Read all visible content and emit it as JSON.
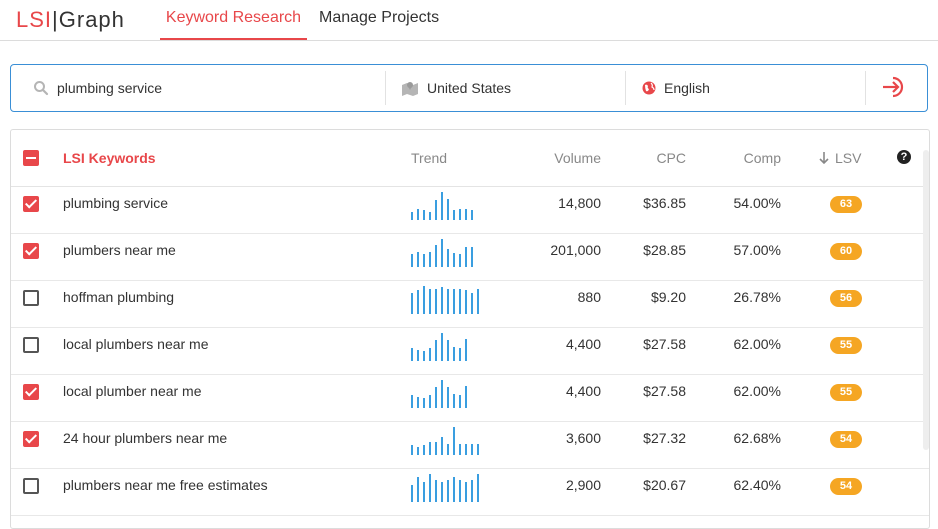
{
  "header": {
    "logo_lsi": "LSI",
    "logo_graph": "Graph",
    "nav": [
      "Keyword Research",
      "Manage Projects"
    ]
  },
  "search": {
    "keyword": "plumbing service",
    "country": "United States",
    "language": "English"
  },
  "table": {
    "columns": {
      "keyword": "LSI Keywords",
      "trend": "Trend",
      "volume": "Volume",
      "cpc": "CPC",
      "comp": "Comp",
      "lsv": "LSV"
    },
    "rows": [
      {
        "checked": true,
        "keyword": "plumbing service",
        "volume": "14,800",
        "cpc": "$36.85",
        "comp": "54.00%",
        "lsv": "63",
        "trend": [
          0.3,
          0.4,
          0.35,
          0.3,
          0.7,
          1.0,
          0.75,
          0.35,
          0.4,
          0.4,
          0.35
        ]
      },
      {
        "checked": true,
        "keyword": "plumbers near me",
        "volume": "201,000",
        "cpc": "$28.85",
        "comp": "57.00%",
        "lsv": "60",
        "trend": [
          0.45,
          0.55,
          0.45,
          0.55,
          0.8,
          1.0,
          0.65,
          0.5,
          0.45,
          0.7,
          0.7
        ]
      },
      {
        "checked": false,
        "keyword": "hoffman plumbing",
        "volume": "880",
        "cpc": "$9.20",
        "comp": "26.78%",
        "lsv": "56",
        "trend": [
          0.75,
          0.85,
          1.0,
          0.9,
          0.9,
          0.95,
          0.9,
          0.9,
          0.9,
          0.85,
          0.75,
          0.9
        ]
      },
      {
        "checked": false,
        "keyword": "local plumbers near me",
        "volume": "4,400",
        "cpc": "$27.58",
        "comp": "62.00%",
        "lsv": "55",
        "trend": [
          0.45,
          0.4,
          0.35,
          0.45,
          0.75,
          1.0,
          0.75,
          0.5,
          0.45,
          0.8
        ]
      },
      {
        "checked": true,
        "keyword": "local plumber near me",
        "volume": "4,400",
        "cpc": "$27.58",
        "comp": "62.00%",
        "lsv": "55",
        "trend": [
          0.45,
          0.4,
          0.35,
          0.45,
          0.75,
          1.0,
          0.75,
          0.5,
          0.45,
          0.8
        ]
      },
      {
        "checked": true,
        "keyword": "24 hour plumbers near me",
        "volume": "3,600",
        "cpc": "$27.32",
        "comp": "62.68%",
        "lsv": "54",
        "trend": [
          0.35,
          0.3,
          0.35,
          0.45,
          0.45,
          0.65,
          0.4,
          1.0,
          0.4,
          0.4,
          0.4,
          0.4
        ]
      },
      {
        "checked": false,
        "keyword": "plumbers near me free estimates",
        "volume": "2,900",
        "cpc": "$20.67",
        "comp": "62.40%",
        "lsv": "54",
        "trend": [
          0.6,
          0.9,
          0.7,
          1.0,
          0.8,
          0.7,
          0.8,
          0.9,
          0.8,
          0.7,
          0.8,
          1.0
        ]
      }
    ]
  },
  "colors": {
    "accent": "#e8474a",
    "trend": "#3a9ee0",
    "badge": "#f5a623",
    "focus_border": "#3a8fd6"
  },
  "icons": {
    "search": "search-icon",
    "location": "map-icon",
    "language": "globe-icon",
    "submit": "enter-arrow-icon",
    "sort": "arrow-down-icon",
    "help": "question-icon"
  }
}
